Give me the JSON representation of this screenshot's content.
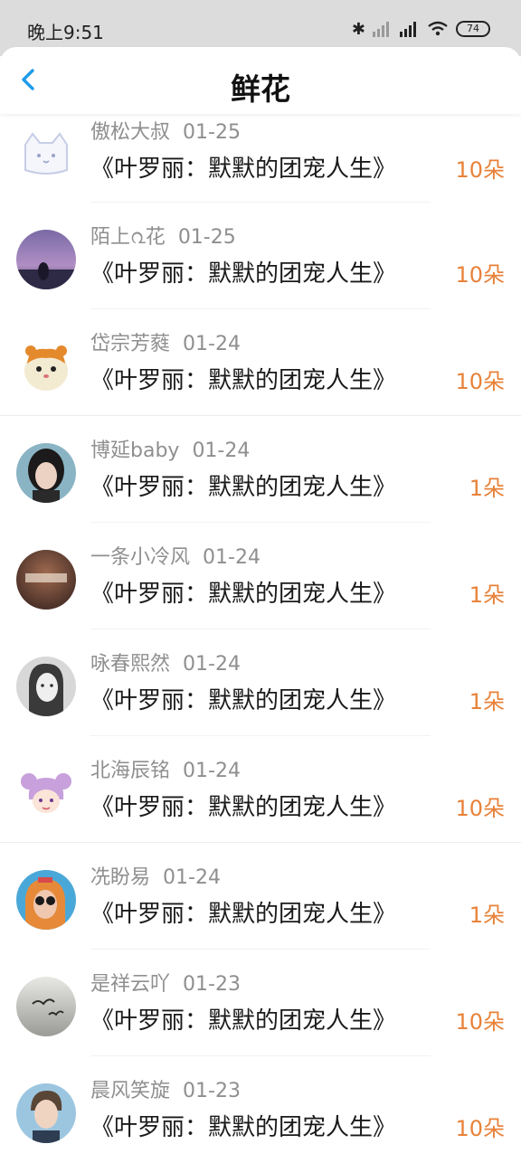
{
  "status_bar": {
    "time": "晚上9:51",
    "battery": "74"
  },
  "nav": {
    "title": "鲜花"
  },
  "items": [
    {
      "user": "傲松大叔",
      "date": "01-25",
      "book": "《叶罗丽：默默的团宠人生》",
      "amount": "10朵",
      "avatar": "cat-icon"
    },
    {
      "user": "陌上൨花",
      "date": "01-25",
      "book": "《叶罗丽：默默的团宠人生》",
      "amount": "10朵",
      "avatar": "purple-sky-photo"
    },
    {
      "user": "岱宗芳蕤",
      "date": "01-24",
      "book": "《叶罗丽：默默的团宠人生》",
      "amount": "10朵",
      "avatar": "hamster-cartoon"
    },
    {
      "user": "博延baby",
      "date": "01-24",
      "book": "《叶罗丽：默默的团宠人生》",
      "amount": "1朵",
      "avatar": "portrait-photo"
    },
    {
      "user": "一条小冷风",
      "date": "01-24",
      "book": "《叶罗丽：默默的团宠人生》",
      "amount": "1朵",
      "avatar": "brown-sign-photo"
    },
    {
      "user": "咏春熙然",
      "date": "01-24",
      "book": "《叶罗丽：默默的团宠人生》",
      "amount": "1朵",
      "avatar": "bw-portrait-photo"
    },
    {
      "user": "北海辰铭",
      "date": "01-24",
      "book": "《叶罗丽：默默的团宠人生》",
      "amount": "10朵",
      "avatar": "anime-girl-cartoon"
    },
    {
      "user": "冼盼易",
      "date": "01-24",
      "book": "《叶罗丽：默默的团宠人生》",
      "amount": "1朵",
      "avatar": "sunglasses-photo"
    },
    {
      "user": "是祥云吖",
      "date": "01-23",
      "book": "《叶罗丽：默默的团宠人生》",
      "amount": "10朵",
      "avatar": "birds-sky-photo"
    },
    {
      "user": "晨风笑旋",
      "date": "01-23",
      "book": "《叶罗丽：默默的团宠人生》",
      "amount": "10朵",
      "avatar": "boy-portrait-photo"
    }
  ]
}
